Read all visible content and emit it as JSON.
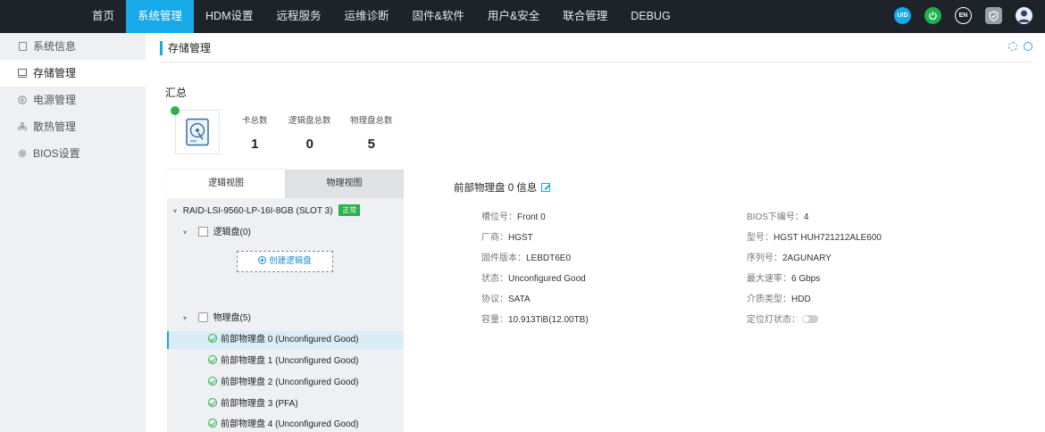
{
  "nav": {
    "items": [
      "首页",
      "系统管理",
      "HDM设置",
      "远程服务",
      "运维诊断",
      "固件&软件",
      "用户&安全",
      "联合管理",
      "DEBUG"
    ],
    "active_index": 1,
    "icons": [
      {
        "name": "uid-icon",
        "text": "UID",
        "color": "#17a9e8"
      },
      {
        "name": "power-icon",
        "text": "",
        "color": "#1fb14f"
      },
      {
        "name": "language-icon",
        "text": "EN",
        "color": "#1e2329"
      },
      {
        "name": "security-shield-icon",
        "text": "",
        "color": "#9aa0a6"
      },
      {
        "name": "user-avatar-icon",
        "text": "",
        "color": "#e8eef5"
      }
    ]
  },
  "sidebar": {
    "items": [
      {
        "label": "系统信息",
        "icon": "doc-icon"
      },
      {
        "label": "存储管理",
        "icon": "storage-icon"
      },
      {
        "label": "电源管理",
        "icon": "power-icon"
      },
      {
        "label": "散热管理",
        "icon": "fan-icon"
      },
      {
        "label": "BIOS设置",
        "icon": "gear-icon"
      }
    ],
    "active_index": 1
  },
  "page": {
    "title": "存储管理",
    "summary_title": "汇总",
    "stats": [
      {
        "label": "卡总数",
        "value": "1"
      },
      {
        "label": "逻辑盘总数",
        "value": "0"
      },
      {
        "label": "物理盘总数",
        "value": "5"
      }
    ]
  },
  "tree": {
    "tabs": [
      "逻辑视图",
      "物理视图"
    ],
    "controller": "RAID-LSI-9560-LP-16I-8GB (SLOT 3)",
    "controller_status": "正常",
    "logical_group": "逻辑盘(0)",
    "create_button": "创建逻辑盘",
    "physical_group": "物理盘(5)",
    "disks": [
      "前部物理盘 0 (Unconfigured Good)",
      "前部物理盘 1 (Unconfigured Good)",
      "前部物理盘 2 (Unconfigured Good)",
      "前部物理盘 3 (PFA)",
      "前部物理盘 4 (Unconfigured Good)"
    ],
    "selected_disk_index": 0
  },
  "detail": {
    "title": "前部物理盘 0 信息",
    "left": [
      {
        "k": "槽位号：",
        "v": "Front 0"
      },
      {
        "k": "厂商：",
        "v": "HGST"
      },
      {
        "k": "固件版本：",
        "v": "LEBDT6E0"
      },
      {
        "k": "状态：",
        "v": "Unconfigured Good"
      },
      {
        "k": "协议：",
        "v": "SATA"
      },
      {
        "k": "容量：",
        "v": "10.913TiB(12.00TB)"
      }
    ],
    "right": [
      {
        "k": "BIOS下编号：",
        "v": "4"
      },
      {
        "k": "型号：",
        "v": "HGST HUH721212ALE600"
      },
      {
        "k": "序列号：",
        "v": "2AGUNARY"
      },
      {
        "k": "最大速率：",
        "v": "6 Gbps"
      },
      {
        "k": "介质类型：",
        "v": "HDD"
      },
      {
        "k": "定位灯状态：",
        "v": ""
      }
    ],
    "locator_led_on": false
  }
}
